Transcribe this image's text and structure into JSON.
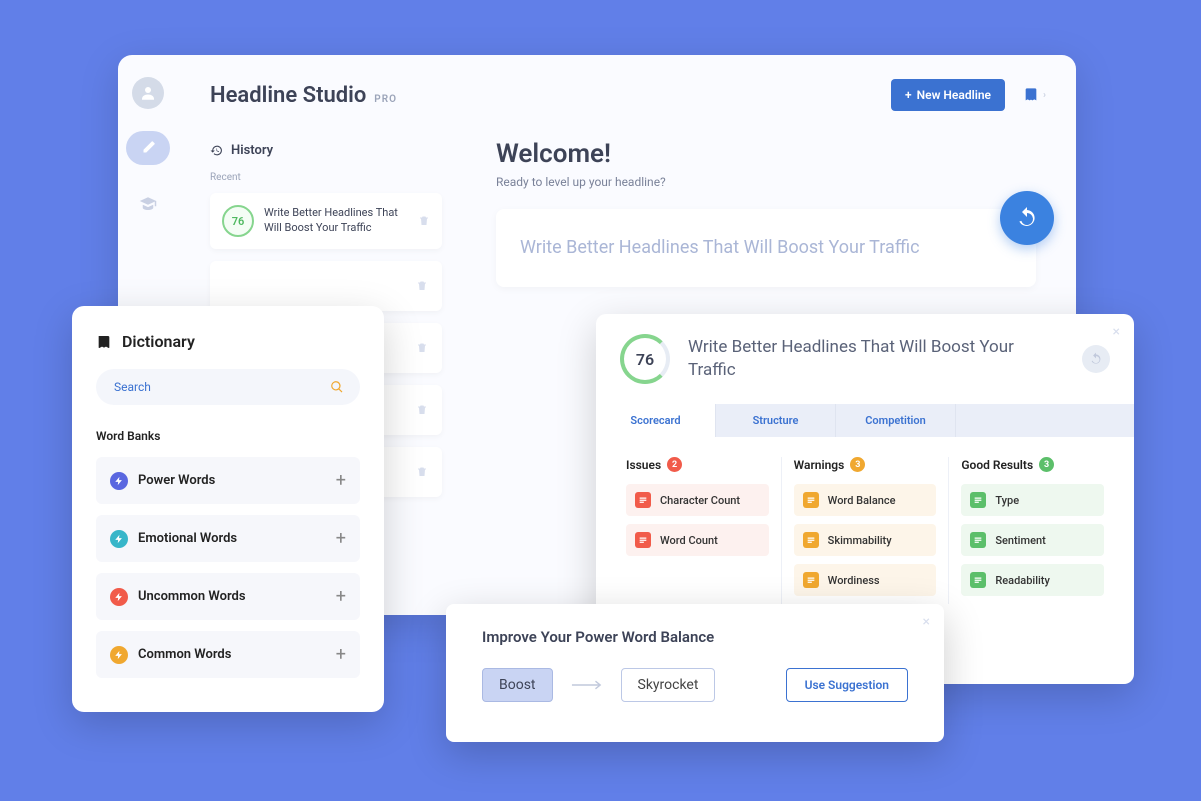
{
  "app": {
    "title": "Headline Studio",
    "badge": "PRO",
    "newButton": "New Headline"
  },
  "history": {
    "title": "History",
    "recentLabel": "Recent",
    "items": [
      {
        "score": "76",
        "text": "Write Better Headlines That Will Boost Your Traffic"
      }
    ]
  },
  "welcome": {
    "title": "Welcome!",
    "subtitle": "Ready to level up your headline?",
    "headline": "Write Better Headlines That Will Boost Your Traffic"
  },
  "dictionary": {
    "title": "Dictionary",
    "searchPlaceholder": "Search",
    "wordBanksLabel": "Word Banks",
    "banks": [
      {
        "name": "Power Words",
        "color": "#5a67e0"
      },
      {
        "name": "Emotional Words",
        "color": "#37b6c9"
      },
      {
        "name": "Uncommon Words",
        "color": "#f15b4a"
      },
      {
        "name": "Common Words",
        "color": "#f0a830"
      }
    ]
  },
  "scorecard": {
    "score": "76",
    "headline": "Write Better Headlines That Will Boost Your Traffic",
    "tabs": [
      "Scorecard",
      "Structure",
      "Competition"
    ],
    "columns": {
      "issues": {
        "label": "Issues",
        "count": "2",
        "items": [
          "Character Count",
          "Word Count"
        ]
      },
      "warnings": {
        "label": "Warnings",
        "count": "3",
        "items": [
          "Word Balance",
          "Skimmability",
          "Wordiness"
        ]
      },
      "good": {
        "label": "Good Results",
        "count": "3",
        "items": [
          "Type",
          "Sentiment",
          "Readability"
        ]
      }
    }
  },
  "suggestion": {
    "title": "Improve Your Power Word Balance",
    "from": "Boost",
    "to": "Skyrocket",
    "button": "Use Suggestion"
  }
}
